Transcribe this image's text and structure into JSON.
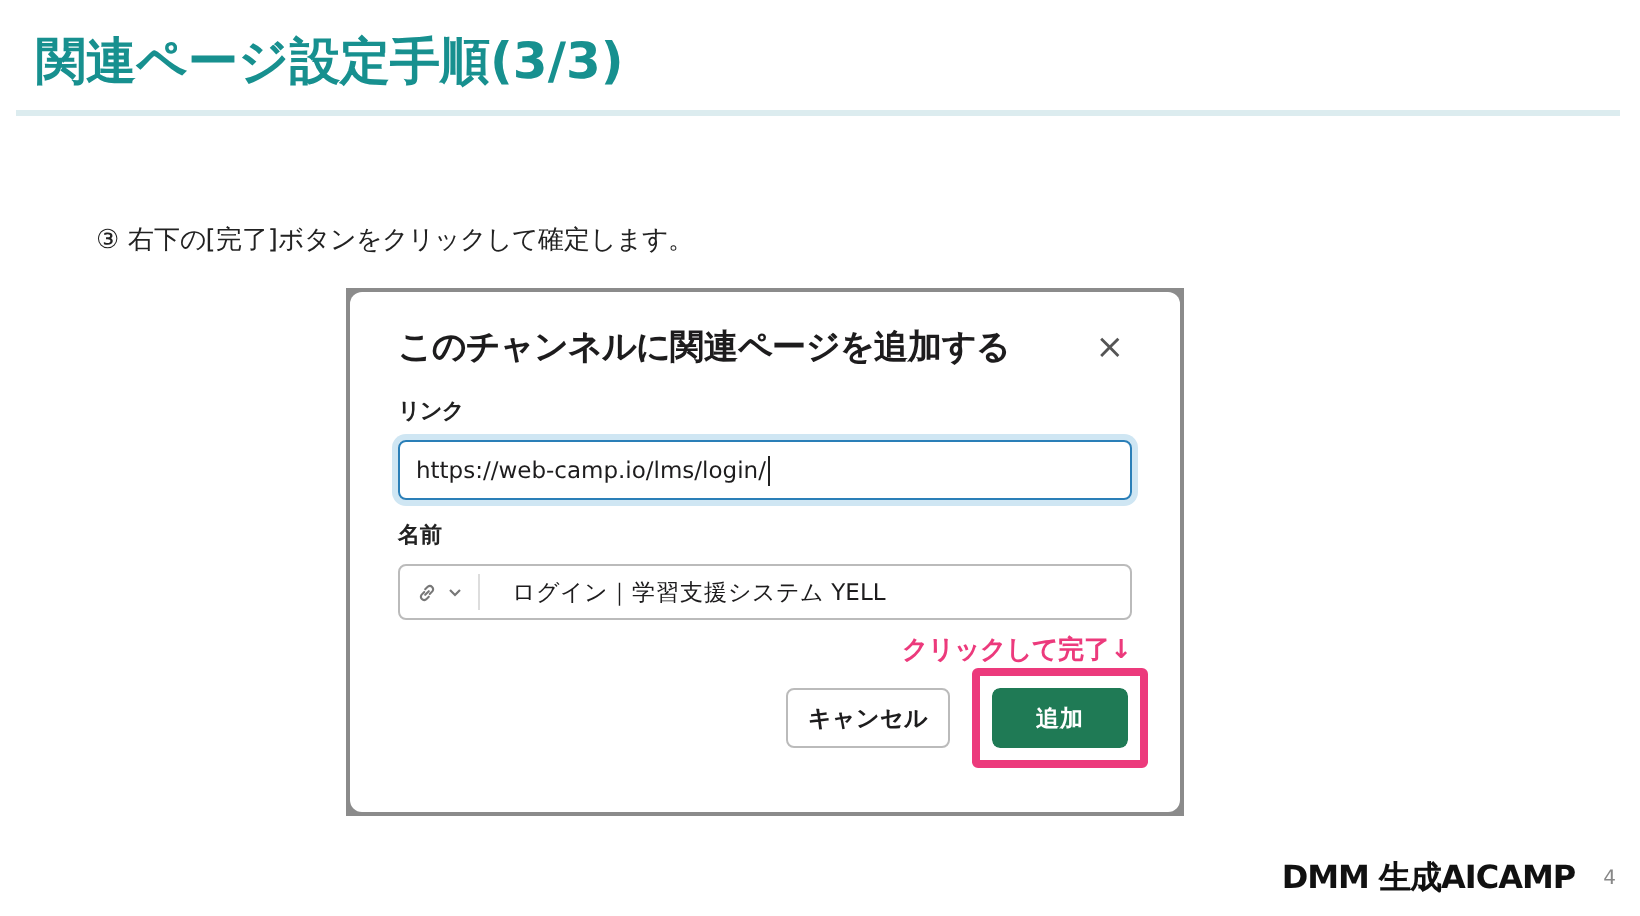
{
  "slide": {
    "title": "関連ページ設定手順(3/3)",
    "instruction": "③ 右下の[完了]ボタンをクリックして確定します。",
    "logo": "DMM 生成AICAMP",
    "page_number": "4"
  },
  "dialog": {
    "title": "このチャンネルに関連ページを追加する",
    "close": "×",
    "fields": [
      {
        "kind": "text",
        "label": "リンク",
        "value": "https://web-camp.io/lms/login/",
        "focused": true
      },
      {
        "kind": "icon_text",
        "label": "名前",
        "value": "ログイン｜学習支援システム YELL",
        "focused": false
      }
    ],
    "annotation": "クリックして完了↓",
    "buttons": [
      {
        "kind": "secondary",
        "label": "キャンセル",
        "highlighted": false
      },
      {
        "kind": "primary",
        "label": "追加",
        "highlighted": true
      }
    ]
  }
}
